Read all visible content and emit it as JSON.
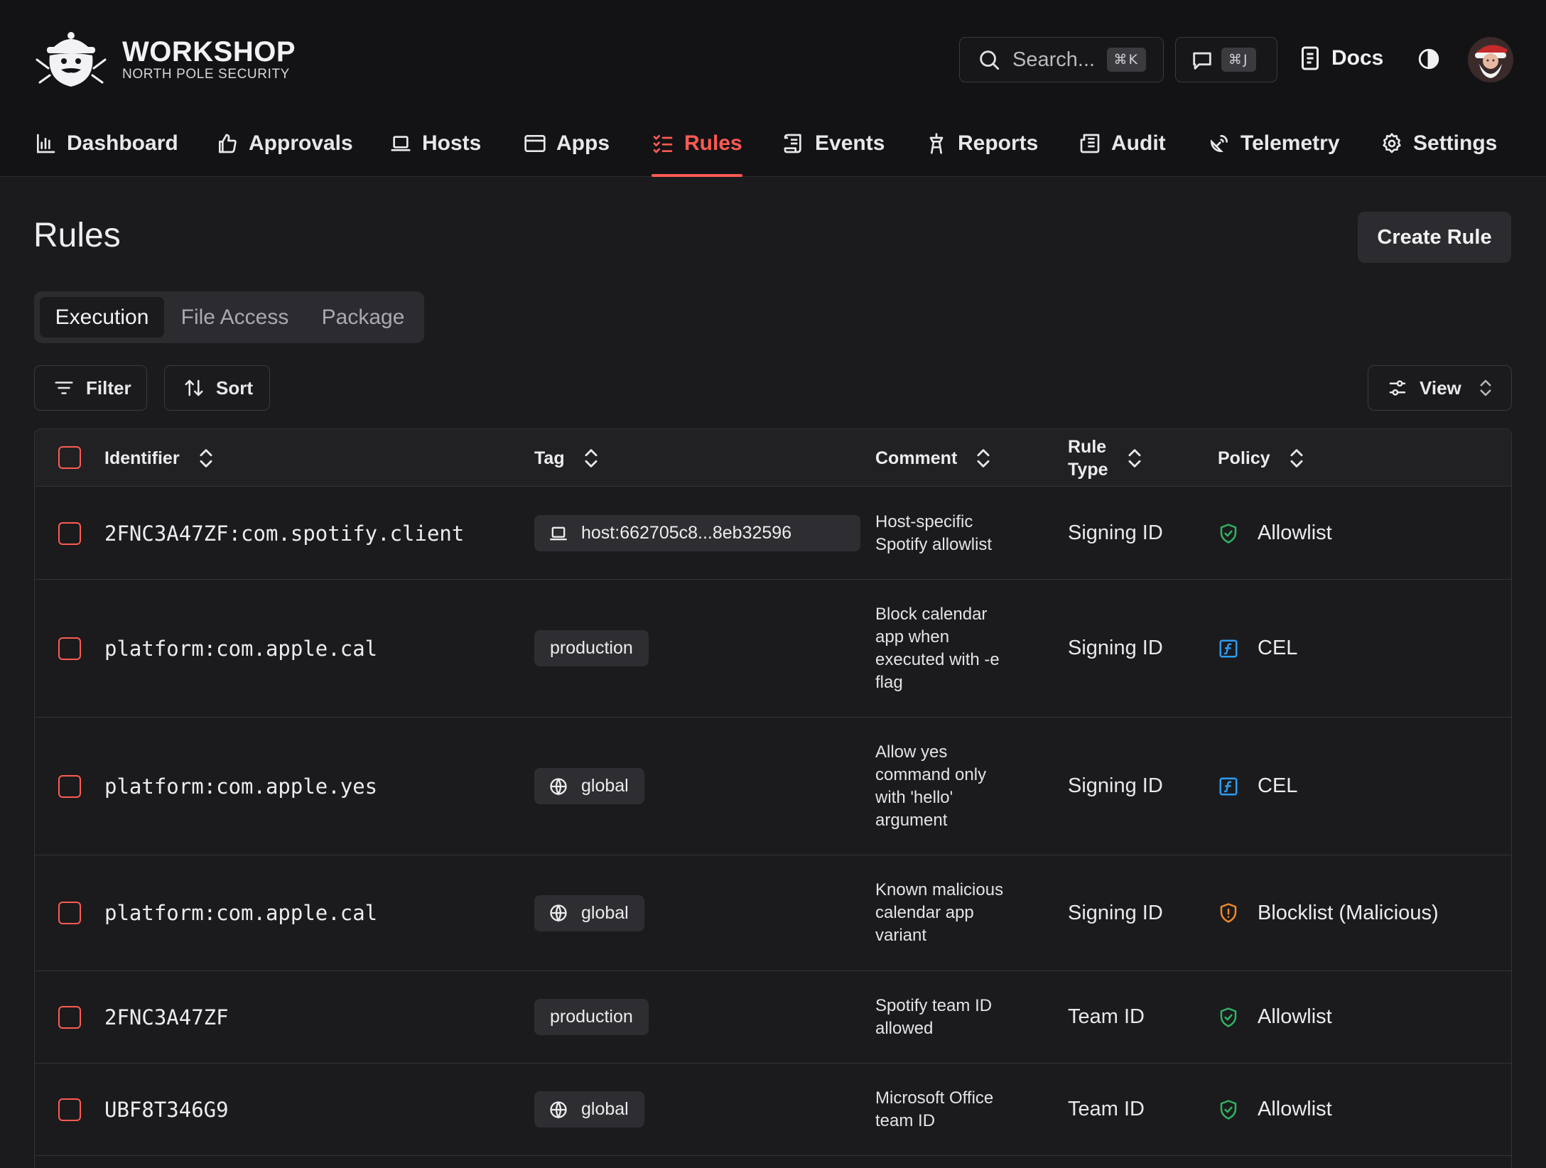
{
  "brand": {
    "title": "WORKSHOP",
    "subtitle": "NORTH POLE SECURITY"
  },
  "search": {
    "placeholder": "Search...",
    "shortcut": "⌘K"
  },
  "chat": {
    "shortcut": "⌘J"
  },
  "docs": {
    "label": "Docs"
  },
  "nav": {
    "dashboard": "Dashboard",
    "approvals": "Approvals",
    "hosts": "Hosts",
    "apps": "Apps",
    "rules": "Rules",
    "events": "Events",
    "reports": "Reports",
    "audit": "Audit",
    "telemetry": "Telemetry",
    "settings": "Settings",
    "active": "Rules"
  },
  "page": {
    "title": "Rules",
    "create_label": "Create Rule"
  },
  "tabs": {
    "execution": "Execution",
    "file_access": "File Access",
    "package": "Package",
    "active": "Execution"
  },
  "toolbar": {
    "filter": "Filter",
    "sort": "Sort",
    "view": "View"
  },
  "table": {
    "columns": {
      "identifier": "Identifier",
      "tag": "Tag",
      "comment": "Comment",
      "rule_type_1": "Rule",
      "rule_type_2": "Type",
      "policy": "Policy"
    },
    "rows": [
      {
        "identifier": "2FNC3A47ZF:com.spotify.client",
        "tag": "host:662705c8...8eb32596",
        "tag_icon": "laptop-icon",
        "comment": "Host-specific Spotify allowlist",
        "rule_type": "Signing ID",
        "policy": "Allowlist",
        "policy_icon": "shield-check-icon"
      },
      {
        "identifier": "platform:com.apple.cal",
        "tag": "production",
        "tag_icon": "",
        "comment": "Block calendar app when executed with -e flag",
        "rule_type": "Signing ID",
        "policy": "CEL",
        "policy_icon": "function-icon"
      },
      {
        "identifier": "platform:com.apple.yes",
        "tag": "global",
        "tag_icon": "globe-icon",
        "comment": "Allow yes command only with 'hello' argument",
        "rule_type": "Signing ID",
        "policy": "CEL",
        "policy_icon": "function-icon"
      },
      {
        "identifier": "platform:com.apple.cal",
        "tag": "global",
        "tag_icon": "globe-icon",
        "comment": "Known malicious calendar app variant",
        "rule_type": "Signing ID",
        "policy": "Blocklist (Malicious)",
        "policy_icon": "shield-alert-icon"
      },
      {
        "identifier": "2FNC3A47ZF",
        "tag": "production",
        "tag_icon": "",
        "comment": "Spotify team ID allowed",
        "rule_type": "Team ID",
        "policy": "Allowlist",
        "policy_icon": "shield-check-icon"
      },
      {
        "identifier": "UBF8T346G9",
        "tag": "global",
        "tag_icon": "globe-icon",
        "comment": "Microsoft Office team ID",
        "rule_type": "Team ID",
        "policy": "Allowlist",
        "policy_icon": "shield-check-icon"
      }
    ]
  },
  "colors": {
    "accent": "#ff5a52",
    "allow": "#2fb463",
    "cel": "#2d9bf0",
    "block": "#f08a24",
    "background": "#1b1b1d",
    "header_bg": "#131316"
  }
}
